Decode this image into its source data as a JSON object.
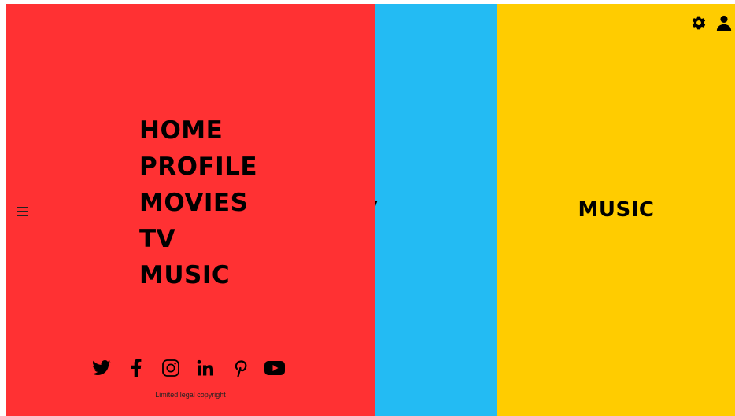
{
  "panels": {
    "tv": {
      "label": "TV",
      "color": "#23BBF3"
    },
    "music": {
      "label": "MUSIC",
      "color": "#FFCC00"
    }
  },
  "menu": {
    "background": "#FF3133",
    "toggle_icon": "hamburger-icon",
    "items": [
      {
        "label": "HOME"
      },
      {
        "label": "PROFILE"
      },
      {
        "label": "MOVIES"
      },
      {
        "label": "TV"
      },
      {
        "label": "MUSIC"
      }
    ],
    "social": [
      {
        "icon": "twitter-icon"
      },
      {
        "icon": "facebook-icon"
      },
      {
        "icon": "instagram-icon"
      },
      {
        "icon": "linkedin-icon"
      },
      {
        "icon": "pinterest-icon"
      },
      {
        "icon": "youtube-icon"
      }
    ],
    "copyright": "Limited legal copyright"
  },
  "header": {
    "icons": [
      "gear-icon",
      "user-icon"
    ]
  }
}
